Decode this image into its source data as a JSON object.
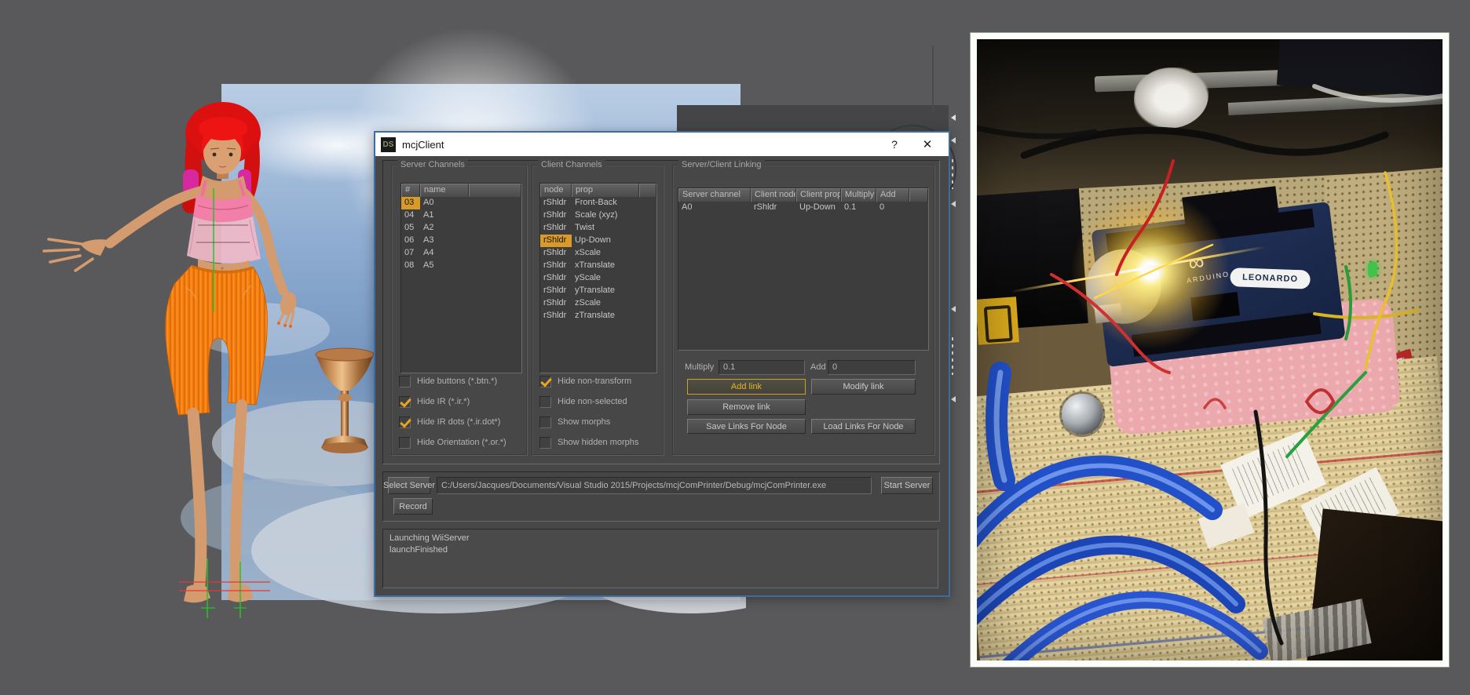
{
  "window": {
    "title": "mcjClient",
    "icon_text": "DS",
    "help_button": "?",
    "close_button": "✕"
  },
  "server_channels": {
    "caption": "Server Channels",
    "columns": [
      "#",
      "name"
    ],
    "rows": [
      {
        "num": "03",
        "name": "A0"
      },
      {
        "num": "04",
        "name": "A1"
      },
      {
        "num": "05",
        "name": "A2"
      },
      {
        "num": "06",
        "name": "A3"
      },
      {
        "num": "07",
        "name": "A4"
      },
      {
        "num": "08",
        "name": "A5"
      }
    ],
    "checkboxes": [
      {
        "label": "Hide buttons (*.btn.*)",
        "checked": false
      },
      {
        "label": "Hide IR (*.ir.*)",
        "checked": true
      },
      {
        "label": "Hide IR dots (*.ir.dot*)",
        "checked": true
      },
      {
        "label": "Hide Orientation (*.or.*)",
        "checked": false
      }
    ]
  },
  "client_channels": {
    "caption": "Client Channels",
    "columns": [
      "node",
      "prop"
    ],
    "rows": [
      {
        "node": "rShldr",
        "prop": "Front-Back"
      },
      {
        "node": "rShldr",
        "prop": "Scale (xyz)"
      },
      {
        "node": "rShldr",
        "prop": "Twist"
      },
      {
        "node": "rShldr",
        "prop": "Up-Down"
      },
      {
        "node": "rShldr",
        "prop": "xScale"
      },
      {
        "node": "rShldr",
        "prop": "xTranslate"
      },
      {
        "node": "rShldr",
        "prop": "yScale"
      },
      {
        "node": "rShldr",
        "prop": "yTranslate"
      },
      {
        "node": "rShldr",
        "prop": "zScale"
      },
      {
        "node": "rShldr",
        "prop": "zTranslate"
      }
    ],
    "checkboxes": [
      {
        "label": "Hide non-transform",
        "checked": true
      },
      {
        "label": "Hide non-selected",
        "checked": false
      },
      {
        "label": "Show morphs",
        "checked": false
      },
      {
        "label": "Show hidden morphs",
        "checked": false
      }
    ]
  },
  "linking": {
    "caption": "Server/Client Linking",
    "columns": [
      "Server channel",
      "Client node",
      "Client prop",
      "Multiply",
      "Add"
    ],
    "rows": [
      {
        "server_channel": "A0",
        "client_node": "rShldr",
        "client_prop": "Up-Down",
        "multiply": "0.1",
        "add": "0"
      }
    ],
    "multiply_label": "Multiply",
    "multiply_value": "0.1",
    "add_label": "Add",
    "add_value": "0",
    "buttons": {
      "add_link": "Add link",
      "modify_link": "Modify link",
      "remove_link": "Remove link",
      "save_links": "Save Links For Node",
      "load_links": "Load Links For Node"
    }
  },
  "server_controls": {
    "select_server": "Select Server",
    "server_path": "C:/Users/Jacques/Documents/Visual Studio 2015/Projects/mcjComPrinter/Debug/mcjComPrinter.exe",
    "start_server": "Start Server",
    "record": "Record"
  },
  "log": {
    "lines": [
      "Launching WiiServer",
      "launchFinished"
    ]
  },
  "photo": {
    "board_brand": "ARDUINO",
    "board_model": "LEONARDO"
  },
  "colors": {
    "selection_highlight": "#d89a28",
    "check_mark": "#e8a51d",
    "dialog_border": "#3f6ba1",
    "add_link_accent": "#c9a227",
    "desktop_background": "#59595b"
  }
}
